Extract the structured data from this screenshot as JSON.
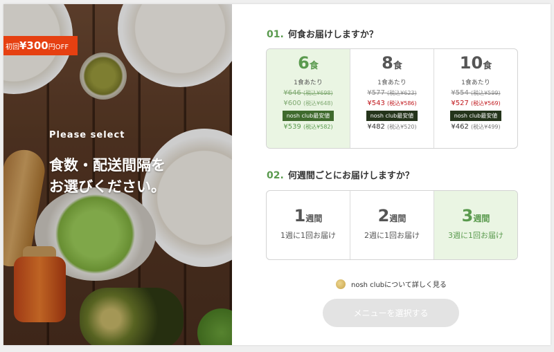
{
  "promo": {
    "prefix": "初回",
    "amount": "¥300",
    "suffix": "円OFF"
  },
  "left_panel": {
    "label": "Please select",
    "heading": "食数・配送間隔を\nお選びください。"
  },
  "q1": {
    "number": "01.",
    "title": "何食お届けしますか？",
    "options": [
      {
        "count": "6",
        "unit": "食",
        "per": "1食あたり",
        "list_price": "¥646",
        "list_tax": "(税込¥698)",
        "discount_price": "¥600",
        "discount_tax": "(税込¥648)",
        "club_label": "nosh club最安値",
        "club_price": "¥539",
        "club_tax": "(税込¥582)",
        "selected": true
      },
      {
        "count": "8",
        "unit": "食",
        "per": "1食あたり",
        "list_price": "¥577",
        "list_tax": "(税込¥623)",
        "discount_price": "¥543",
        "discount_tax": "(税込¥586)",
        "club_label": "nosh club最安値",
        "club_price": "¥482",
        "club_tax": "(税込¥520)",
        "selected": false
      },
      {
        "count": "10",
        "unit": "食",
        "per": "1食あたり",
        "list_price": "¥554",
        "list_tax": "(税込¥599)",
        "discount_price": "¥527",
        "discount_tax": "(税込¥569)",
        "club_label": "nosh club最安値",
        "club_price": "¥462",
        "club_tax": "(税込¥499)",
        "selected": false
      }
    ]
  },
  "q2": {
    "number": "02.",
    "title": "何週間ごとにお届けしますか？",
    "options": [
      {
        "count": "1",
        "unit": "週間",
        "sub": "1週に1回お届け",
        "selected": false
      },
      {
        "count": "2",
        "unit": "週間",
        "sub": "2週に1回お届け",
        "selected": false
      },
      {
        "count": "3",
        "unit": "週間",
        "sub": "3週に1回お届け",
        "selected": true
      }
    ]
  },
  "club_link": {
    "text": "nosh clubについて詳しく見る",
    "icon": "coin-icon"
  },
  "select_button": {
    "label": "メニューを選択する",
    "state": "disabled"
  },
  "colors": {
    "accent_green": "#5a9a4e",
    "selected_bg": "#eaf5e3",
    "discount_red": "#c0171c",
    "promo_orange": "#e64011",
    "badge_dark": "#24341b",
    "button_disabled": "#e3e3e3"
  }
}
